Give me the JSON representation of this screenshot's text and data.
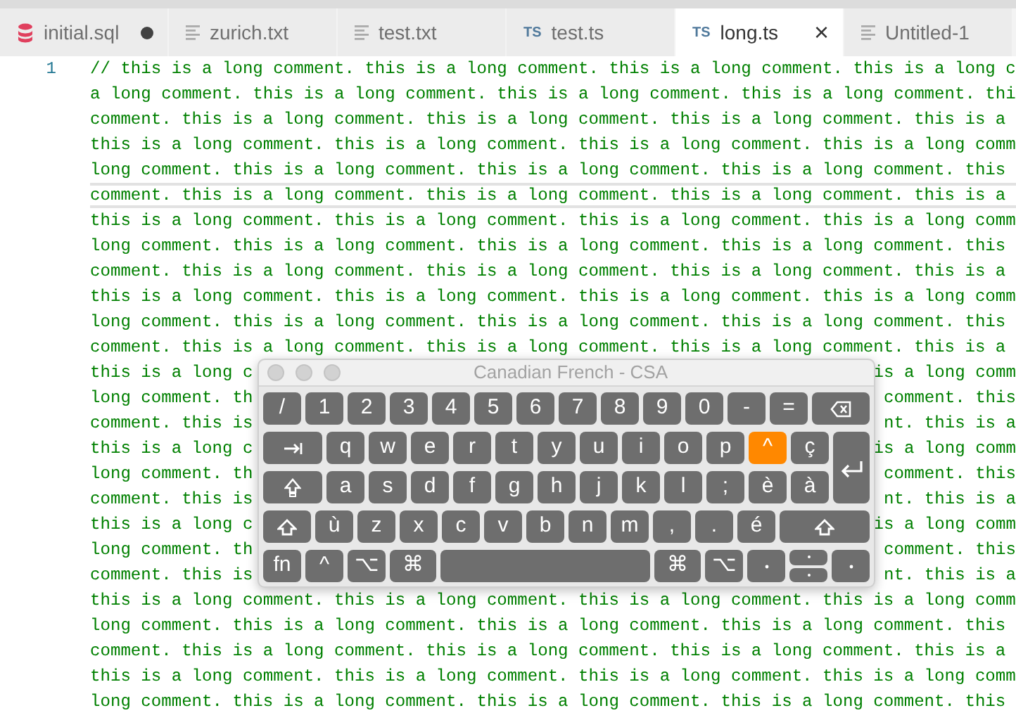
{
  "tabs": [
    {
      "label": "initial.sql",
      "kind": "sql",
      "selected": false,
      "dirty": true
    },
    {
      "label": "zurich.txt",
      "kind": "text",
      "selected": false,
      "dirty": false
    },
    {
      "label": "test.txt",
      "kind": "text",
      "selected": false,
      "dirty": false
    },
    {
      "label": "test.ts",
      "kind": "typescript",
      "badge": "TS",
      "selected": false,
      "dirty": false
    },
    {
      "label": "long.ts",
      "kind": "typescript",
      "badge": "TS",
      "selected": true,
      "dirty": false,
      "close": "×"
    },
    {
      "label": "Untitled-1",
      "kind": "text",
      "selected": false,
      "dirty": false
    }
  ],
  "editor": {
    "lines": [
      {
        "number": "1",
        "text": "// this is a long comment. this is a long comment. this is a long comment. this is a long c",
        "current": false
      },
      {
        "text": "a long comment. this is a long comment. this is a long comment. this is a long comment. thi",
        "current": false
      },
      {
        "text": "comment. this is a long comment. this is a long comment. this is a long comment. this is a",
        "current": false
      },
      {
        "text": "this is a long comment. this is a long comment. this is a long comment. this is a long comm",
        "current": false
      },
      {
        "text": "long comment. this is a long comment. this is a long comment. this is a long comment. this",
        "current": false
      },
      {
        "text": "comment. this is a long comment. this is a long comment. this is a long comment. this is a",
        "current": true
      },
      {
        "text": "this is a long comment. this is a long comment. this is a long comment. this is a long comm",
        "current": false
      },
      {
        "text": "long comment. this is a long comment. this is a long comment. this is a long comment. this",
        "current": false
      },
      {
        "text": "comment. this is a long comment. this is a long comment. this is a long comment. this is a",
        "current": false
      },
      {
        "text": "this is a long comment. this is a long comment. this is a long comment. this is a long comm",
        "current": false
      },
      {
        "text": "long comment. this is a long comment. this is a long comment. this is a long comment. this",
        "current": false
      },
      {
        "text": "comment. this is a long comment. this is a long comment. this is a long comment. this is a",
        "current": false
      },
      {
        "left": "this is a long c",
        "right": "is a long comm",
        "current": false
      },
      {
        "left": "long comment. th",
        "right": "comment. this",
        "current": false
      },
      {
        "left": "comment. this is",
        "right": "nt. this is a",
        "current": false
      },
      {
        "left": "this is a long c",
        "right": "is a long comm",
        "current": false
      },
      {
        "left": "long comment. th",
        "right": "comment. this",
        "current": false
      },
      {
        "left": "comment. this is",
        "right": "nt. this is a",
        "current": false
      },
      {
        "left": "this is a long c",
        "right": "is a long comm",
        "current": false
      },
      {
        "left": "long comment. th",
        "right": "comment. this",
        "current": false
      },
      {
        "left": "comment. this is",
        "right": "nt. this is a",
        "current": false
      },
      {
        "text": "this is a long comment. this is a long comment. this is a long comment. this is a long comm",
        "current": false
      },
      {
        "text": "long comment. this is a long comment. this is a long comment. this is a long comment. this",
        "current": false
      },
      {
        "text": "comment. this is a long comment. this is a long comment. this is a long comment. this is a",
        "current": false
      },
      {
        "text": "this is a long comment. this is a long comment. this is a long comment. this is a long comm",
        "current": false
      },
      {
        "text": "long comment. this is a long comment. this is a long comment. this is a long comment. this",
        "current": false
      }
    ]
  },
  "keyboard": {
    "title": "Canadian French - CSA",
    "rows": [
      {
        "keys": [
          {
            "label": "/",
            "kind": "char",
            "pressed": false
          },
          {
            "label": "1",
            "kind": "char",
            "pressed": false
          },
          {
            "label": "2",
            "kind": "char",
            "pressed": false
          },
          {
            "label": "3",
            "kind": "char",
            "pressed": false
          },
          {
            "label": "4",
            "kind": "char",
            "pressed": false
          },
          {
            "label": "5",
            "kind": "char",
            "pressed": false
          },
          {
            "label": "6",
            "kind": "char",
            "pressed": false
          },
          {
            "label": "7",
            "kind": "char",
            "pressed": false
          },
          {
            "label": "8",
            "kind": "char",
            "pressed": false
          },
          {
            "label": "9",
            "kind": "char",
            "pressed": false
          },
          {
            "label": "0",
            "kind": "char",
            "pressed": false
          },
          {
            "label": "-",
            "kind": "char",
            "pressed": false
          },
          {
            "label": "=",
            "kind": "char",
            "pressed": false
          },
          {
            "kind": "delete",
            "pressed": false
          }
        ]
      },
      {
        "keys": [
          {
            "kind": "tab",
            "pressed": false
          },
          {
            "label": "q",
            "kind": "char",
            "pressed": false
          },
          {
            "label": "w",
            "kind": "char",
            "pressed": false
          },
          {
            "label": "e",
            "kind": "char",
            "pressed": false
          },
          {
            "label": "r",
            "kind": "char",
            "pressed": false
          },
          {
            "label": "t",
            "kind": "char",
            "pressed": false
          },
          {
            "label": "y",
            "kind": "char",
            "pressed": false
          },
          {
            "label": "u",
            "kind": "char",
            "pressed": false
          },
          {
            "label": "i",
            "kind": "char",
            "pressed": false
          },
          {
            "label": "o",
            "kind": "char",
            "pressed": false
          },
          {
            "label": "p",
            "kind": "char",
            "pressed": false
          },
          {
            "label": "^",
            "kind": "char",
            "pressed": true
          },
          {
            "label": "ç",
            "kind": "char",
            "pressed": false
          },
          {
            "kind": "return",
            "pressed": false
          }
        ]
      },
      {
        "keys": [
          {
            "kind": "caps",
            "pressed": false
          },
          {
            "label": "a",
            "kind": "char",
            "pressed": false
          },
          {
            "label": "s",
            "kind": "char",
            "pressed": false
          },
          {
            "label": "d",
            "kind": "char",
            "pressed": false
          },
          {
            "label": "f",
            "kind": "char",
            "pressed": false
          },
          {
            "label": "g",
            "kind": "char",
            "pressed": false
          },
          {
            "label": "h",
            "kind": "char",
            "pressed": false
          },
          {
            "label": "j",
            "kind": "char",
            "pressed": false
          },
          {
            "label": "k",
            "kind": "char",
            "pressed": false
          },
          {
            "label": "l",
            "kind": "char",
            "pressed": false
          },
          {
            "label": ";",
            "kind": "char",
            "pressed": false
          },
          {
            "label": "è",
            "kind": "char",
            "pressed": false
          },
          {
            "label": "à",
            "kind": "char",
            "pressed": false
          }
        ]
      },
      {
        "keys": [
          {
            "kind": "shift",
            "pressed": false
          },
          {
            "label": "ù",
            "kind": "char",
            "pressed": false
          },
          {
            "label": "z",
            "kind": "char",
            "pressed": false
          },
          {
            "label": "x",
            "kind": "char",
            "pressed": false
          },
          {
            "label": "c",
            "kind": "char",
            "pressed": false
          },
          {
            "label": "v",
            "kind": "char",
            "pressed": false
          },
          {
            "label": "b",
            "kind": "char",
            "pressed": false
          },
          {
            "label": "n",
            "kind": "char",
            "pressed": false
          },
          {
            "label": "m",
            "kind": "char",
            "pressed": false
          },
          {
            "label": ",",
            "kind": "char",
            "pressed": false
          },
          {
            "label": ".",
            "kind": "char",
            "pressed": false
          },
          {
            "label": "é",
            "kind": "char",
            "pressed": false
          },
          {
            "kind": "shift",
            "pressed": false
          }
        ]
      },
      {
        "keys": [
          {
            "label": "fn",
            "kind": "char",
            "pressed": false
          },
          {
            "label": "^",
            "kind": "char",
            "pressed": false
          },
          {
            "label": "⌥",
            "kind": "char",
            "pressed": false
          },
          {
            "label": "⌘",
            "kind": "mod",
            "pressed": false
          },
          {
            "kind": "space",
            "pressed": false
          },
          {
            "label": "⌘",
            "kind": "mod",
            "pressed": false
          },
          {
            "label": "⌥",
            "kind": "char",
            "pressed": false
          },
          {
            "kind": "arrow-left",
            "pressed": false
          },
          {
            "kind": "arrow-updown",
            "pressed": false
          },
          {
            "kind": "arrow-right",
            "pressed": false
          }
        ]
      }
    ]
  }
}
